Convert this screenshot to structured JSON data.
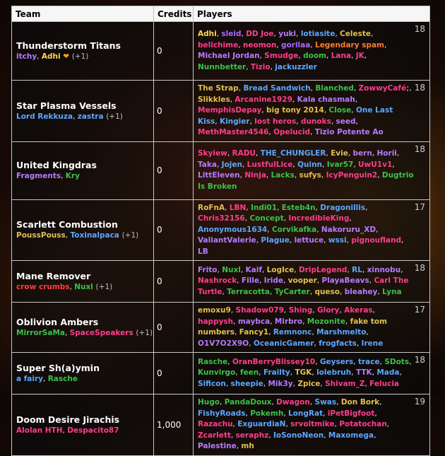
{
  "headers": {
    "team": "Team",
    "credits": "Credits",
    "players": "Players"
  },
  "teams": [
    {
      "name": "Thunderstorm Titans",
      "credits": "0",
      "count": "18",
      "meta": [
        {
          "t": "itchy",
          "c": "#b57bff"
        },
        {
          "t": "Adhi",
          "c": "#ffd84d",
          "heart": "❤"
        }
      ],
      "extra": "(+1)",
      "players": [
        {
          "t": "Adhi",
          "c": "#ffd84d"
        },
        {
          "t": "sleid",
          "c": "#a56bff"
        },
        {
          "t": "DD Joe",
          "c": "#ff3d8b"
        },
        {
          "t": "yuki",
          "c": "#b57bff"
        },
        {
          "t": "lotiasite",
          "c": "#5aa7ff"
        },
        {
          "t": "Celeste",
          "c": "#e0c050"
        },
        {
          "t": "belichime",
          "c": "#ff3d8b"
        },
        {
          "t": "neomon",
          "c": "#ff3d8b"
        },
        {
          "t": "gorilaa",
          "c": "#a56bff"
        },
        {
          "t": "Legendary spam",
          "c": "#ff7a2e"
        },
        {
          "t": "Michael Jordan",
          "c": "#b57bff"
        },
        {
          "t": "Smudge",
          "c": "#ff3d8b"
        },
        {
          "t": "doom",
          "c": "#39c24a"
        },
        {
          "t": "Lana",
          "c": "#ff3d8b"
        },
        {
          "t": "JK",
          "c": "#ff3d8b"
        },
        {
          "t": "Nunnbetter",
          "c": "#39c24a"
        },
        {
          "t": "Tizio",
          "c": "#ff3d8b"
        },
        {
          "t": "jackuzzler",
          "c": "#5aa7ff"
        }
      ]
    },
    {
      "name": "Star Plasma Vessels",
      "credits": "0",
      "count": "18",
      "meta": [
        {
          "t": "Lord Rekkuza",
          "c": "#5aa7ff"
        },
        {
          "t": "zastra",
          "c": "#5aa7ff"
        }
      ],
      "extra": "(+1)",
      "players": [
        {
          "t": "The Strap",
          "c": "#e0c050"
        },
        {
          "t": "Bread Sandwich",
          "c": "#5aa7ff"
        },
        {
          "t": "Blanched",
          "c": "#39c24a"
        },
        {
          "t": "ZowwyCafé;",
          "c": "#ff3d8b"
        },
        {
          "t": "Slikkles",
          "c": "#e0c050"
        },
        {
          "t": "Arcanine1929",
          "c": "#ff3d8b"
        },
        {
          "t": "Kala chasmah",
          "c": "#b57bff"
        },
        {
          "t": "MemphisDepay",
          "c": "#ff3d8b"
        },
        {
          "t": "big tony 2014",
          "c": "#e0c050"
        },
        {
          "t": "Close",
          "c": "#39c24a"
        },
        {
          "t": "One Last Kiss",
          "c": "#5aa7ff"
        },
        {
          "t": "Kingier",
          "c": "#5aa7ff"
        },
        {
          "t": "lost heros",
          "c": "#ff3d8b"
        },
        {
          "t": "dunoks",
          "c": "#ff3d8b"
        },
        {
          "t": "seed",
          "c": "#b57bff"
        },
        {
          "t": "MethMaster4546",
          "c": "#ff3d8b"
        },
        {
          "t": "Opelucid",
          "c": "#ff3d8b"
        },
        {
          "t": "Tizio Potente Ao",
          "c": "#b57bff"
        }
      ]
    },
    {
      "name": "United Kingdras",
      "credits": "0",
      "count": "18",
      "meta": [
        {
          "t": "Fragments",
          "c": "#b57bff"
        },
        {
          "t": "Kry",
          "c": "#39c24a"
        }
      ],
      "extra": "",
      "players": [
        {
          "t": "Skyiew",
          "c": "#ff3d8b"
        },
        {
          "t": "RADU",
          "c": "#ff3d8b"
        },
        {
          "t": "THE_CHUNGLER",
          "c": "#5aa7ff"
        },
        {
          "t": "Evie",
          "c": "#e0c050"
        },
        {
          "t": "bern",
          "c": "#b57bff"
        },
        {
          "t": "Horii",
          "c": "#b57bff"
        },
        {
          "t": "Taka",
          "c": "#b57bff"
        },
        {
          "t": "Jojen",
          "c": "#5aa7ff"
        },
        {
          "t": "LustfulLice",
          "c": "#ff3d8b"
        },
        {
          "t": "Quinn",
          "c": "#5aa7ff"
        },
        {
          "t": "Ivar57",
          "c": "#39c24a"
        },
        {
          "t": "UwU1v1",
          "c": "#ff3d8b"
        },
        {
          "t": "LittEleven",
          "c": "#b57bff"
        },
        {
          "t": "Ninja",
          "c": "#ff3d8b"
        },
        {
          "t": "Lacks",
          "c": "#39c24a"
        },
        {
          "t": "sufys",
          "c": "#e0c050"
        },
        {
          "t": "IcyPenguin2",
          "c": "#ff3d8b"
        },
        {
          "t": "Dugtrio Is Broken",
          "c": "#39c24a"
        }
      ]
    },
    {
      "name": "Scarlett Combustion",
      "credits": "0",
      "count": "17",
      "meta": [
        {
          "t": "PoussPouss",
          "c": "#e0c050"
        },
        {
          "t": "Toxinalpaca",
          "c": "#5aa7ff"
        }
      ],
      "extra": "(+1)",
      "players": [
        {
          "t": "RoFnA",
          "c": "#e0c050"
        },
        {
          "t": "LBN",
          "c": "#ff3d8b"
        },
        {
          "t": "Indi01",
          "c": "#39c24a"
        },
        {
          "t": "Esteb4n",
          "c": "#39c24a"
        },
        {
          "t": "Dragonillis",
          "c": "#5aa7ff"
        },
        {
          "t": "Chris32156",
          "c": "#ff3d8b"
        },
        {
          "t": "Concept",
          "c": "#39c24a"
        },
        {
          "t": "IncredibleKing",
          "c": "#ff3d8b"
        },
        {
          "t": "Anonymous1634",
          "c": "#5aa7ff"
        },
        {
          "t": "Corvikafka",
          "c": "#39c24a"
        },
        {
          "t": "Nakoruru_XD",
          "c": "#b57bff"
        },
        {
          "t": "ValiantValerie",
          "c": "#b57bff"
        },
        {
          "t": "Plague",
          "c": "#5aa7ff"
        },
        {
          "t": "lettuce",
          "c": "#b57bff"
        },
        {
          "t": "wssi",
          "c": "#5aa7ff"
        },
        {
          "t": "pignoufland",
          "c": "#ff3d8b"
        },
        {
          "t": "LB",
          "c": "#b57bff"
        }
      ]
    },
    {
      "name": "Mane Remover",
      "credits": "0",
      "count": "18",
      "meta": [
        {
          "t": "crow crumbs",
          "c": "#ff3d3d"
        },
        {
          "t": "Nuxl",
          "c": "#39c24a"
        }
      ],
      "extra": "(+1)",
      "players": [
        {
          "t": "Frito",
          "c": "#b57bff"
        },
        {
          "t": "Nuxl",
          "c": "#39c24a"
        },
        {
          "t": "Kaif",
          "c": "#b57bff"
        },
        {
          "t": "LogIce",
          "c": "#e0c050"
        },
        {
          "t": "DripLegend",
          "c": "#ff3d8b"
        },
        {
          "t": "RL",
          "c": "#5aa7ff"
        },
        {
          "t": "xinnobu",
          "c": "#b57bff"
        },
        {
          "t": "Nashrock",
          "c": "#ff3d8b"
        },
        {
          "t": "Fille",
          "c": "#b57bff"
        },
        {
          "t": "Iride",
          "c": "#b57bff"
        },
        {
          "t": "vooper",
          "c": "#e0c050"
        },
        {
          "t": "PlayaBeavs",
          "c": "#b57bff"
        },
        {
          "t": "Carl The Turtle",
          "c": "#ff3d8b"
        },
        {
          "t": "Terracotta",
          "c": "#39c24a"
        },
        {
          "t": "TyCarter",
          "c": "#39c24a"
        },
        {
          "t": "queso",
          "c": "#e0c050"
        },
        {
          "t": "bleahey",
          "c": "#b57bff"
        },
        {
          "t": "Lyna",
          "c": "#39c24a"
        }
      ]
    },
    {
      "name": "Oblivion Ambers",
      "credits": "0",
      "count": "17",
      "meta": [
        {
          "t": "MirrorSaMa",
          "c": "#39c24a"
        },
        {
          "t": "SpaceSpeakers",
          "c": "#ff3d8b"
        }
      ],
      "extra": "(+1)",
      "players": [
        {
          "t": "emoxu9",
          "c": "#e0c050"
        },
        {
          "t": "Shadow079",
          "c": "#ff3d8b"
        },
        {
          "t": "Shing",
          "c": "#ff3d8b"
        },
        {
          "t": "Glory",
          "c": "#ff3d8b"
        },
        {
          "t": "Akeras",
          "c": "#ff3d8b"
        },
        {
          "t": "happysh",
          "c": "#ff3d8b"
        },
        {
          "t": "maybca",
          "c": "#b57bff"
        },
        {
          "t": "Mirbro",
          "c": "#b57bff"
        },
        {
          "t": "Mozonite",
          "c": "#39c24a"
        },
        {
          "t": "fake tom numbers",
          "c": "#e0c050"
        },
        {
          "t": "Fancy1",
          "c": "#e0c050"
        },
        {
          "t": "Remnonc",
          "c": "#5aa7ff"
        },
        {
          "t": "Marshmelto",
          "c": "#5aa7ff"
        },
        {
          "t": "O1V7O2X9O",
          "c": "#b57bff"
        },
        {
          "t": "OceanicGamer",
          "c": "#5aa7ff"
        },
        {
          "t": "frogfacts",
          "c": "#5aa7ff"
        },
        {
          "t": "Irene",
          "c": "#5aa7ff"
        }
      ]
    },
    {
      "name": "Super Sh(a)ymin",
      "credits": "0",
      "count": "18",
      "meta": [
        {
          "t": "a fairy",
          "c": "#5aa7ff"
        },
        {
          "t": "Rasche",
          "c": "#39c24a"
        }
      ],
      "extra": "",
      "players": [
        {
          "t": "Rasche",
          "c": "#39c24a"
        },
        {
          "t": "OranBerryBlissey10",
          "c": "#ff3d8b"
        },
        {
          "t": "Geysers",
          "c": "#5aa7ff"
        },
        {
          "t": "trace",
          "c": "#5aa7ff"
        },
        {
          "t": "SDots",
          "c": "#39c24a"
        },
        {
          "t": "Kunvirgo",
          "c": "#39c24a"
        },
        {
          "t": "feen",
          "c": "#39c24a"
        },
        {
          "t": "Frailty",
          "c": "#5aa7ff"
        },
        {
          "t": "TGK",
          "c": "#e0c050"
        },
        {
          "t": "lolebruh",
          "c": "#5aa7ff"
        },
        {
          "t": "TTK",
          "c": "#b57bff"
        },
        {
          "t": "Mada",
          "c": "#5aa7ff"
        },
        {
          "t": "Sificon",
          "c": "#5aa7ff"
        },
        {
          "t": "sheepie",
          "c": "#5aa7ff"
        },
        {
          "t": "Mik3y",
          "c": "#b57bff"
        },
        {
          "t": "Zpice",
          "c": "#e0c050"
        },
        {
          "t": "Shivam_Z",
          "c": "#ff3d8b"
        },
        {
          "t": "Felucia",
          "c": "#ff3d8b"
        }
      ]
    },
    {
      "name": "Doom Desire Jirachis",
      "credits": "1,000",
      "count": "19",
      "meta": [
        {
          "t": "Alolan HTH",
          "c": "#ff3d8b"
        },
        {
          "t": "Despacito87",
          "c": "#ff3d8b"
        }
      ],
      "extra": "",
      "players": [
        {
          "t": "Hugo",
          "c": "#39c24a"
        },
        {
          "t": "PandaDoux",
          "c": "#39c24a"
        },
        {
          "t": "Dwagon",
          "c": "#ff3d8b"
        },
        {
          "t": "Swas",
          "c": "#5aa7ff"
        },
        {
          "t": "Don Bork",
          "c": "#e0c050"
        },
        {
          "t": "FishyRoads",
          "c": "#5aa7ff"
        },
        {
          "t": "Pokemh",
          "c": "#39c24a"
        },
        {
          "t": "LongRat",
          "c": "#5aa7ff"
        },
        {
          "t": "iPetBigfoot",
          "c": "#ff3d8b"
        },
        {
          "t": "Razachu",
          "c": "#ff3d8b"
        },
        {
          "t": "ExguardiaN",
          "c": "#5aa7ff"
        },
        {
          "t": "srvoltmike",
          "c": "#ff3d8b"
        },
        {
          "t": "Potatochan",
          "c": "#ff3d8b"
        },
        {
          "t": "Zcarlett",
          "c": "#ff3d8b"
        },
        {
          "t": "seraphz",
          "c": "#ff3d8b"
        },
        {
          "t": "IoSonoNeon",
          "c": "#5aa7ff"
        },
        {
          "t": "Maxomega",
          "c": "#5aa7ff"
        },
        {
          "t": "Palestine",
          "c": "#b57bff"
        },
        {
          "t": "mh",
          "c": "#e0c050"
        }
      ]
    }
  ]
}
